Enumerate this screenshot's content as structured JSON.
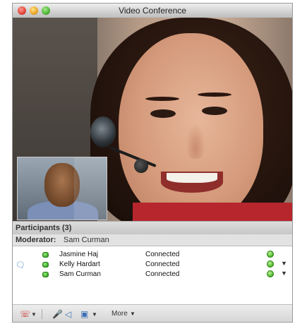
{
  "window": {
    "title": "Video Conference"
  },
  "participants": {
    "header": "Participants (3)",
    "moderator_label": "Moderator:",
    "moderator_name": "Sam Curman",
    "rows": [
      {
        "name": "Jasmine Haj",
        "status": "Connected",
        "has_chat": false,
        "has_menu": false
      },
      {
        "name": "Kelly Hardart",
        "status": "Connected",
        "has_chat": true,
        "has_menu": true
      },
      {
        "name": "Sam Curman",
        "status": "Connected",
        "has_chat": false,
        "has_menu": true
      }
    ]
  },
  "toolbar": {
    "more_label": "More"
  },
  "icons": {
    "chat": "chat-bubble-icon",
    "presence": "presence-green-icon",
    "volume": "volume-indicator-icon",
    "hangup": "phone-hangup-icon",
    "microphone": "microphone-icon",
    "speaker": "speaker-icon",
    "camera": "video-camera-icon"
  },
  "colors": {
    "presence_green": "#38a824",
    "hangup_red": "#c4241d",
    "accent_blue": "#3b6fb7"
  }
}
